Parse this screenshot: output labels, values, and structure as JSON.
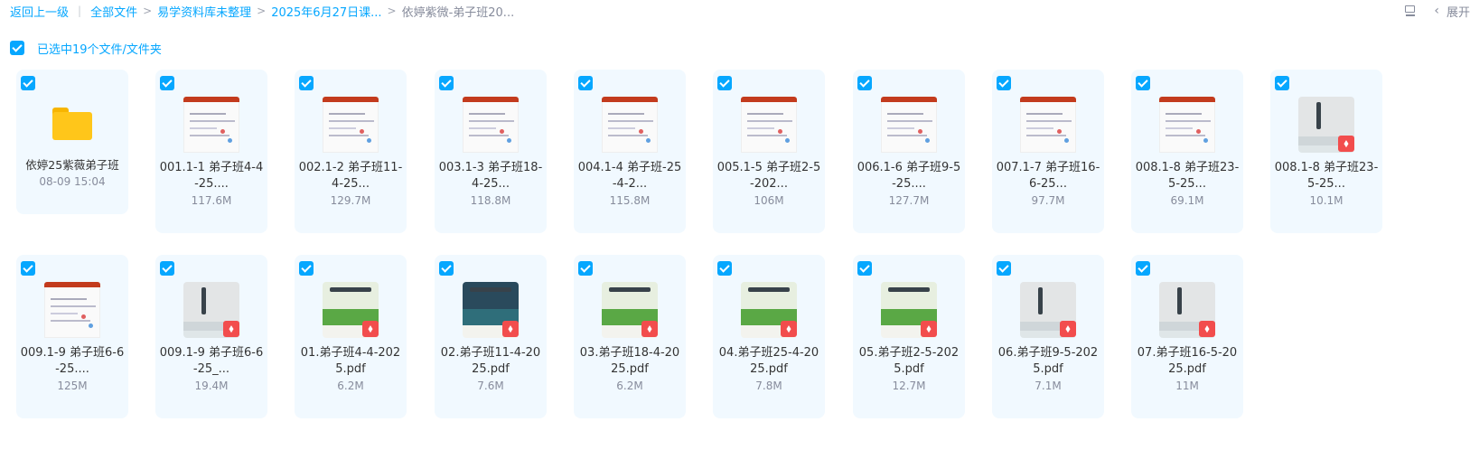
{
  "breadcrumb": {
    "back": "返回上一级",
    "items": [
      "全部文件",
      "易学资料库未整理",
      "2025年6月27日课...",
      "依婷紫微-弟子班20..."
    ]
  },
  "toolbar": {
    "expand_label": "展开",
    "chevron": "‹"
  },
  "selection": {
    "label": "已选中19个文件/文件夹"
  },
  "pdf_badge": "⬧",
  "files": [
    {
      "name": "依婷25紫薇弟子班",
      "meta": "08-09 15:04",
      "type": "folder"
    },
    {
      "name": "001.1-1 弟子班4-4-25....",
      "meta": "117.6M",
      "type": "ppt"
    },
    {
      "name": "002.1-2 弟子班11-4-25...",
      "meta": "129.7M",
      "type": "ppt"
    },
    {
      "name": "003.1-3 弟子班18-4-25...",
      "meta": "118.8M",
      "type": "ppt"
    },
    {
      "name": "004.1-4 弟子班-25-4-2...",
      "meta": "115.8M",
      "type": "ppt"
    },
    {
      "name": "005.1-5 弟子班2-5-202...",
      "meta": "106M",
      "type": "ppt"
    },
    {
      "name": "006.1-6 弟子班9-5-25....",
      "meta": "127.7M",
      "type": "ppt"
    },
    {
      "name": "007.1-7 弟子班16-6-25...",
      "meta": "97.7M",
      "type": "ppt"
    },
    {
      "name": "008.1-8 弟子班23-5-25...",
      "meta": "69.1M",
      "type": "ppt"
    },
    {
      "name": "008.1-8 弟子班23-5-25...",
      "meta": "10.1M",
      "type": "pdf-gray"
    },
    {
      "name": "009.1-9 弟子班6-6-25....",
      "meta": "125M",
      "type": "ppt"
    },
    {
      "name": "009.1-9 弟子班6-6-25_...",
      "meta": "19.4M",
      "type": "pdf-gray"
    },
    {
      "name": "01.弟子班4-4-2025.pdf",
      "meta": "6.2M",
      "type": "pdf"
    },
    {
      "name": "02.弟子班11-4-2025.pdf",
      "meta": "7.6M",
      "type": "pdf-dark"
    },
    {
      "name": "03.弟子班18-4-2025.pdf",
      "meta": "6.2M",
      "type": "pdf"
    },
    {
      "name": "04.弟子班25-4-2025.pdf",
      "meta": "7.8M",
      "type": "pdf"
    },
    {
      "name": "05.弟子班2-5-2025.pdf",
      "meta": "12.7M",
      "type": "pdf"
    },
    {
      "name": "06.弟子班9-5-2025.pdf",
      "meta": "7.1M",
      "type": "pdf-gray"
    },
    {
      "name": "07.弟子班16-5-2025.pdf",
      "meta": "11M",
      "type": "pdf-gray"
    }
  ]
}
